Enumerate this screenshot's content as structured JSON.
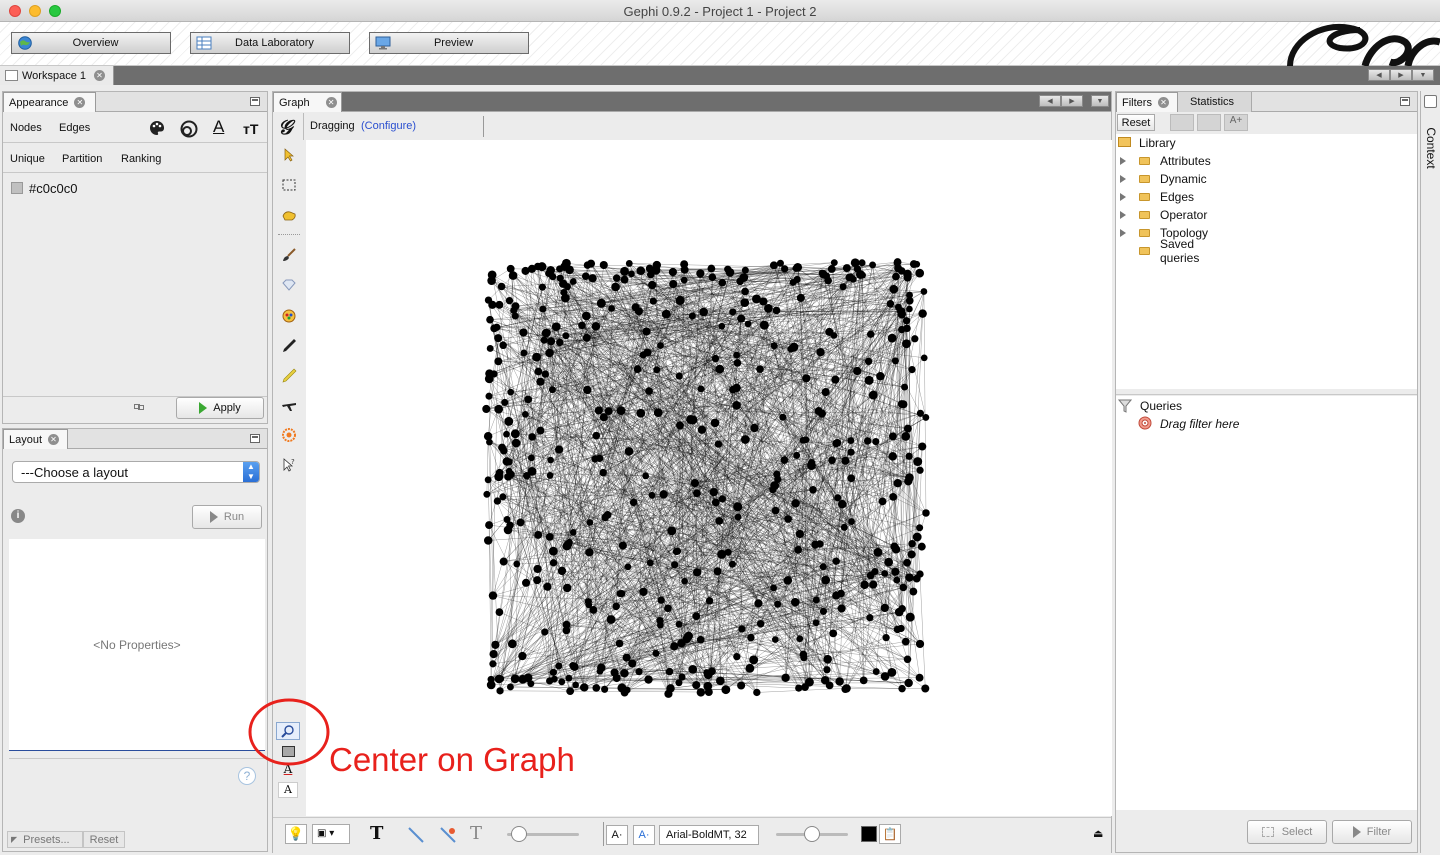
{
  "window": {
    "title": "Gephi 0.9.2 - Project 1 - Project 2"
  },
  "modes": [
    {
      "label": "Overview"
    },
    {
      "label": "Data Laboratory"
    },
    {
      "label": "Preview"
    }
  ],
  "workspace": {
    "tab_label": "Workspace 1"
  },
  "appearance": {
    "tab_label": "Appearance",
    "element_tabs": [
      "Nodes",
      "Edges"
    ],
    "mode_tabs": [
      "Unique",
      "Partition",
      "Ranking"
    ],
    "color_value": "#c0c0c0",
    "apply_label": "Apply"
  },
  "layout": {
    "tab_label": "Layout",
    "select_value": "---Choose a layout",
    "run_label": "Run",
    "no_properties": "<No Properties>",
    "presets_label": "Presets...",
    "reset_label": "Reset"
  },
  "graph": {
    "tab_label": "Graph",
    "tool_label": "Dragging",
    "configure_label": "(Configure)",
    "font_label": "Arial-BoldMT, 32"
  },
  "annotation": {
    "text": "Center on Graph",
    "color": "#e8211c"
  },
  "filters": {
    "tab_label": "Filters",
    "statistics_tab_label": "Statistics",
    "reset_label": "Reset",
    "library_label": "Library",
    "library_items": [
      "Attributes",
      "Dynamic",
      "Edges",
      "Operator",
      "Topology",
      "Saved queries"
    ],
    "queries_label": "Queries",
    "drag_hint": "Drag filter here",
    "select_label": "Select",
    "filter_label": "Filter"
  },
  "context": {
    "label": "Context"
  }
}
